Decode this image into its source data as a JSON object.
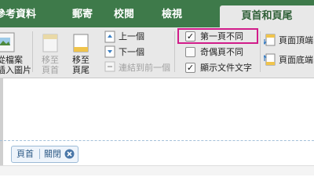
{
  "tabs": [
    {
      "label": "參考資料"
    },
    {
      "label": "郵寄"
    },
    {
      "label": "校閱"
    },
    {
      "label": "檢視"
    },
    {
      "label": "頁首和頁尾",
      "active": true
    }
  ],
  "ribbon": {
    "file_picture": {
      "line1": "從檔案",
      "line2": "插入圖片"
    },
    "go_to_header": {
      "line1": "移至",
      "line2": "頁首",
      "enabled": false
    },
    "go_to_footer": {
      "line1": "移至",
      "line2": "頁尾"
    },
    "previous": "上一個",
    "next": "下一個",
    "link_to_previous": {
      "label": "連結到前一個",
      "enabled": false
    },
    "options": [
      {
        "label": "第一頁不同",
        "checked": true,
        "highlighted": true
      },
      {
        "label": "奇偶頁不同",
        "checked": false
      },
      {
        "label": "顯示文件文字",
        "checked": true
      }
    ],
    "header_top": "頁面頂端",
    "footer_bottom": "頁面底端"
  },
  "header_pane": {
    "header_label": "頁首",
    "close_label": "關閉"
  },
  "colors": {
    "accent_green": "#3e7a4a",
    "highlight_magenta": "#d11c8a",
    "ribbon_bg": "#e8e8e8"
  }
}
